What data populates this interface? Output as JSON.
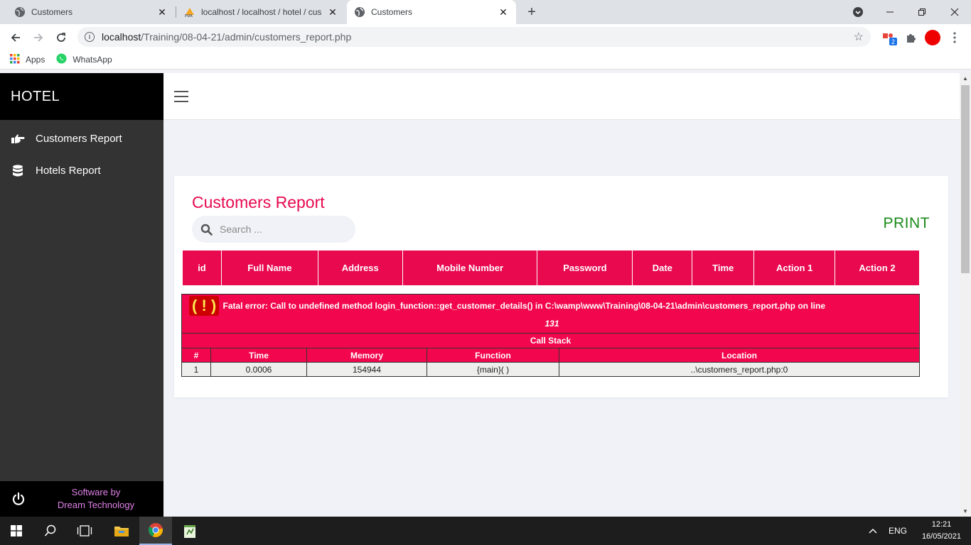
{
  "browser": {
    "tabs": [
      {
        "title": "Customers",
        "active": false
      },
      {
        "title": "localhost / localhost / hotel / cus",
        "active": false
      },
      {
        "title": "Customers",
        "active": true
      }
    ],
    "url_host": "localhost",
    "url_path": "/Training/08-04-21/admin/customers_report.php",
    "extension_badge": "2",
    "bookmarks": [
      "Apps",
      "WhatsApp"
    ]
  },
  "sidebar": {
    "brand": "HOTEL",
    "items": [
      {
        "label": "Customers Report",
        "icon": "hand-point-right-icon"
      },
      {
        "label": "Hotels Report",
        "icon": "database-icon"
      }
    ],
    "footer_line1": "Software by",
    "footer_line2": "Dream Technology"
  },
  "report": {
    "title": "Customers Report",
    "print_label": "PRINT",
    "search_placeholder": "Search ...",
    "columns": [
      "id",
      "Full Name",
      "Address",
      "Mobile Number",
      "Password",
      "Date",
      "Time",
      "Action 1",
      "Action 2"
    ]
  },
  "error": {
    "icon_text": "( ! )",
    "message": "Fatal error: Call to undefined method login_function::get_customer_details() in C:\\wamp\\www\\Training\\08-04-21\\admin\\customers_report.php on line ",
    "line": "131",
    "call_stack_title": "Call Stack",
    "headers": [
      "#",
      "Time",
      "Memory",
      "Function",
      "Location"
    ],
    "rows": [
      [
        "1",
        "0.0006",
        "154944",
        "{main}( )",
        "..\\customers_report.php:0"
      ]
    ]
  },
  "taskbar": {
    "language": "ENG",
    "time": "12:21",
    "date": "16/05/2021"
  },
  "colors": {
    "accent": "#e8094f",
    "print": "#1b8a1b",
    "sidebar_bg": "#333333",
    "credit": "#e080e8"
  }
}
